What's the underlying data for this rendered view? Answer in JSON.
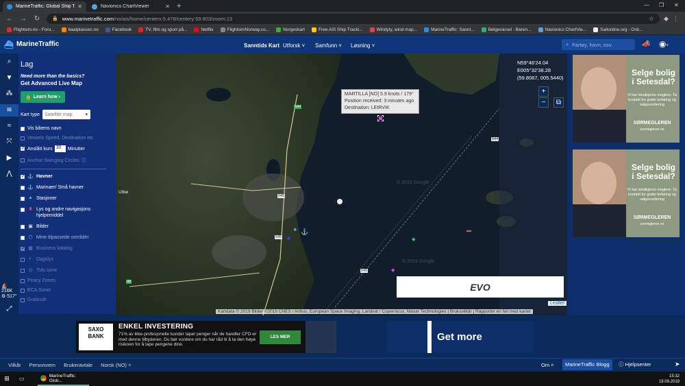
{
  "browser": {
    "tabs": [
      {
        "title": "MarineTraffic: Global Ship Trackin",
        "active": true
      },
      {
        "title": "Navionics ChartViewer",
        "active": false
      }
    ],
    "url_domain": "www.marinetraffic.com",
    "url_path": "/no/ais/home/centerx:5.478/centery:59.803/zoom:13",
    "bookmarks": [
      "Flightsim.no - Foru...",
      "baatplassen.no",
      "Facebook",
      "TV, film og sport på...",
      "Netflix",
      "FlightsimNorway.co...",
      "Norgeskart",
      "Free AIS Ship Tracki...",
      "Windyty, wind map...",
      "MarineTraffic: Sannt...",
      "Bølgevarsel - Baren...",
      "Navionics ChartVie...",
      "Sailonline.org - Onli..."
    ]
  },
  "header": {
    "brand": "MarineTraffic",
    "nav": [
      "Sanntids Kart",
      "Utforsk ˅",
      "Samfunn ˅",
      "Løsning ˅"
    ],
    "search_placeholder": "Fartøy, havn, osv."
  },
  "rail": {
    "stat_vessels": "216K",
    "stat_ports": "517°"
  },
  "panel": {
    "title": "Lag",
    "promo_q": "Need more than the basics?",
    "promo_title": "Get Advanced Live Map",
    "learn_btn": "Learn how ›",
    "kart_type_label": "Kart type",
    "kart_type_value": "Satellite map",
    "opt_names": "Vis båtens navn",
    "opt_speed": "Vessels Speed, Destination etc",
    "opt_course": "Anslått kurs",
    "opt_course_minutes": "30",
    "opt_course_unit": "Minutter",
    "opt_anchor": "Anchor Swinging Circles",
    "layers": [
      {
        "label": "Havner",
        "checked": true,
        "dim": false
      },
      {
        "label": "Marinaer/ Små havner",
        "checked": false,
        "dim": false
      },
      {
        "label": "Stasjoner",
        "checked": false,
        "dim": false
      },
      {
        "label": "Lys og andre navigasjons hjelpemiddel",
        "checked": false,
        "dim": false
      },
      {
        "label": "Bilder",
        "checked": false,
        "dim": false
      },
      {
        "label": "Mine tilpassede områder",
        "checked": false,
        "dim": true
      },
      {
        "label": "Business katalog",
        "checked": true,
        "dim": true
      },
      {
        "label": "Dagslys",
        "checked": false,
        "dim": true
      },
      {
        "label": "Tids sone",
        "checked": false,
        "dim": true
      },
      {
        "label": "Piracy Zones",
        "checked": false,
        "dim": true
      },
      {
        "label": "ECA Soner",
        "checked": false,
        "dim": true
      },
      {
        "label": "Graticule",
        "checked": false,
        "dim": true
      }
    ]
  },
  "map": {
    "coord_lat": "N59°48'24.04",
    "coord_lon": "E005°32'38.28",
    "coord_dec": "(59.8067, 005.5440)",
    "popup_line1": "MARTILLA [NO] 5.9 knots / 179°",
    "popup_line2": "Position received: 3 minutes ago",
    "popup_line3": "Destination: LEIRVIK",
    "zoom_in": "+",
    "zoom_out": "−",
    "road_labels": [
      "544",
      "544",
      "545",
      "545",
      "545",
      "48"
    ],
    "place_label": "Utbø",
    "watermark": "© 2019 Google",
    "leaflet": "Leaflet",
    "attribution": "Kartdata © 2019 Bilder ©2019 CNES / Airbus, European Space Imaging, Landsat / Copernicus, Maxar Technologies | Bruksvilkår | Rapporter en feil med kartet",
    "evo_logo": "EVO"
  },
  "ads": {
    "headline": "Selge bolig i Setesdal?",
    "body": "Vi har lokalkjente meglere. Ta kontakt for gratis befaring og salgsvurdering",
    "brand": "SØRMEGLEREN",
    "site": "sormegleren.no"
  },
  "banner": {
    "saxo_logo_1": "SAXO",
    "saxo_logo_2": "BANK",
    "saxo_title": "ENKEL INVESTERING",
    "saxo_body": "71% av ikke-profesjonelle kunder taper penger når de handler CFD-er med denne tilbyderen. Du bør vurdere om du har råd til å ta den høye risikoen for å tape pengene dine.",
    "saxo_btn": "LES MER",
    "getmore": "Get more"
  },
  "footer": {
    "links": [
      "Vilkår",
      "Personvern",
      "Brukeravtale",
      "Norsk (NO) ˄"
    ],
    "om": "Om ˄",
    "blog": "MarineTraffic Blogg",
    "help": "Hjelpsenter"
  },
  "taskbar": {
    "app": "MarineTraffic: Glob...",
    "time": "15:32",
    "date": "19.09.2019"
  }
}
